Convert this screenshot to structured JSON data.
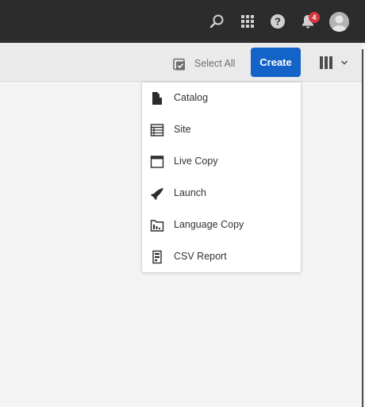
{
  "shell": {
    "notification_count": "4",
    "icons": [
      "search-icon",
      "apps-grid-icon",
      "help-icon",
      "bell-icon",
      "user-avatar-icon"
    ]
  },
  "actionbar": {
    "select_all_label": "Select All",
    "create_label": "Create"
  },
  "create_menu": {
    "items": [
      {
        "label": "Catalog",
        "icon": "catalog-icon"
      },
      {
        "label": "Site",
        "icon": "site-icon"
      },
      {
        "label": "Live Copy",
        "icon": "live-copy-icon"
      },
      {
        "label": "Launch",
        "icon": "launch-icon"
      },
      {
        "label": "Language Copy",
        "icon": "language-copy-icon"
      },
      {
        "label": "CSV Report",
        "icon": "csv-report-icon"
      }
    ]
  },
  "colors": {
    "shell_bg": "#2c2c2c",
    "accent": "#1463c8",
    "badge": "#d7373f",
    "page_bg": "#f3f3f3"
  }
}
